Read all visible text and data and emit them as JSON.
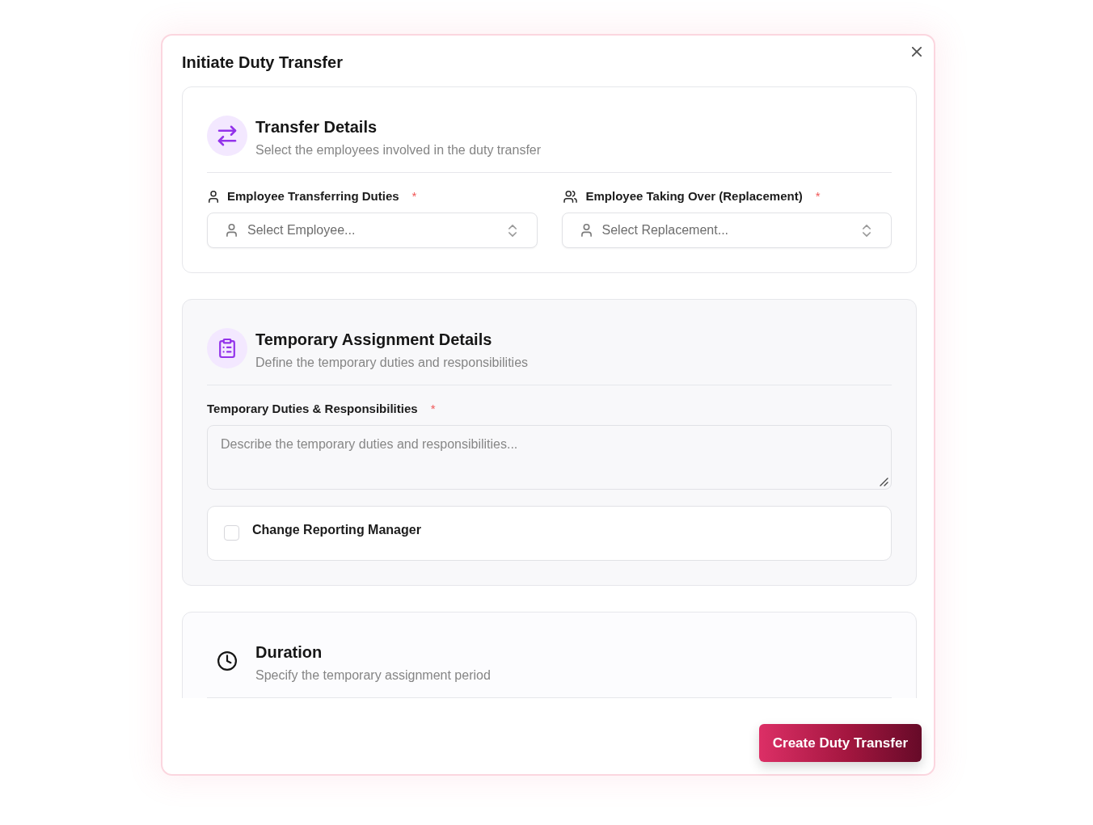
{
  "dialog": {
    "title": "Initiate Duty Transfer"
  },
  "sections": [
    {
      "title": "Transfer Details",
      "subtitle": "Select the employees involved in the duty transfer",
      "fields": [
        {
          "kind": "select",
          "label": "Employee Transferring Duties",
          "required_mark": "*",
          "placeholder": "Select Employee..."
        },
        {
          "kind": "select",
          "label": "Employee Taking Over (Replacement)",
          "required_mark": "*",
          "placeholder": "Select Replacement..."
        }
      ]
    },
    {
      "title": "Temporary Assignment Details",
      "subtitle": "Define the temporary duties and responsibilities",
      "fields": [
        {
          "kind": "textarea",
          "label": "Temporary Duties & Responsibilities",
          "required_mark": "*",
          "placeholder": "Describe the temporary duties and responsibilities..."
        },
        {
          "kind": "checkbox",
          "label": "Change Reporting Manager",
          "checked": false
        }
      ]
    },
    {
      "title": "Duration",
      "subtitle": "Specify the temporary assignment period"
    }
  ],
  "footer": {
    "submit_button": "Create Duty Transfer"
  }
}
